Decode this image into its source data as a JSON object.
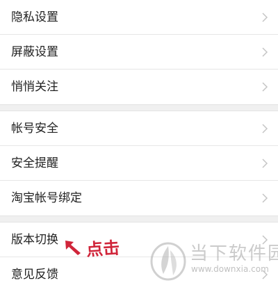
{
  "menu": {
    "group1": [
      {
        "label": "隐私设置"
      },
      {
        "label": "屏蔽设置"
      },
      {
        "label": "悄悄关注"
      }
    ],
    "group2": [
      {
        "label": "帐号安全"
      },
      {
        "label": "安全提醒"
      },
      {
        "label": "淘宝帐号绑定"
      }
    ],
    "group3": [
      {
        "label": "版本切换"
      },
      {
        "label": "意见反馈"
      }
    ]
  },
  "annotation": {
    "text": "点击",
    "color": "#d0253a"
  },
  "watermark": {
    "title": "当下软件园",
    "url": "www.downxia.com"
  },
  "colors": {
    "background": "#f2f2f2",
    "row_background": "#ffffff",
    "chevron": "#c4c4c4",
    "text": "#222222"
  }
}
